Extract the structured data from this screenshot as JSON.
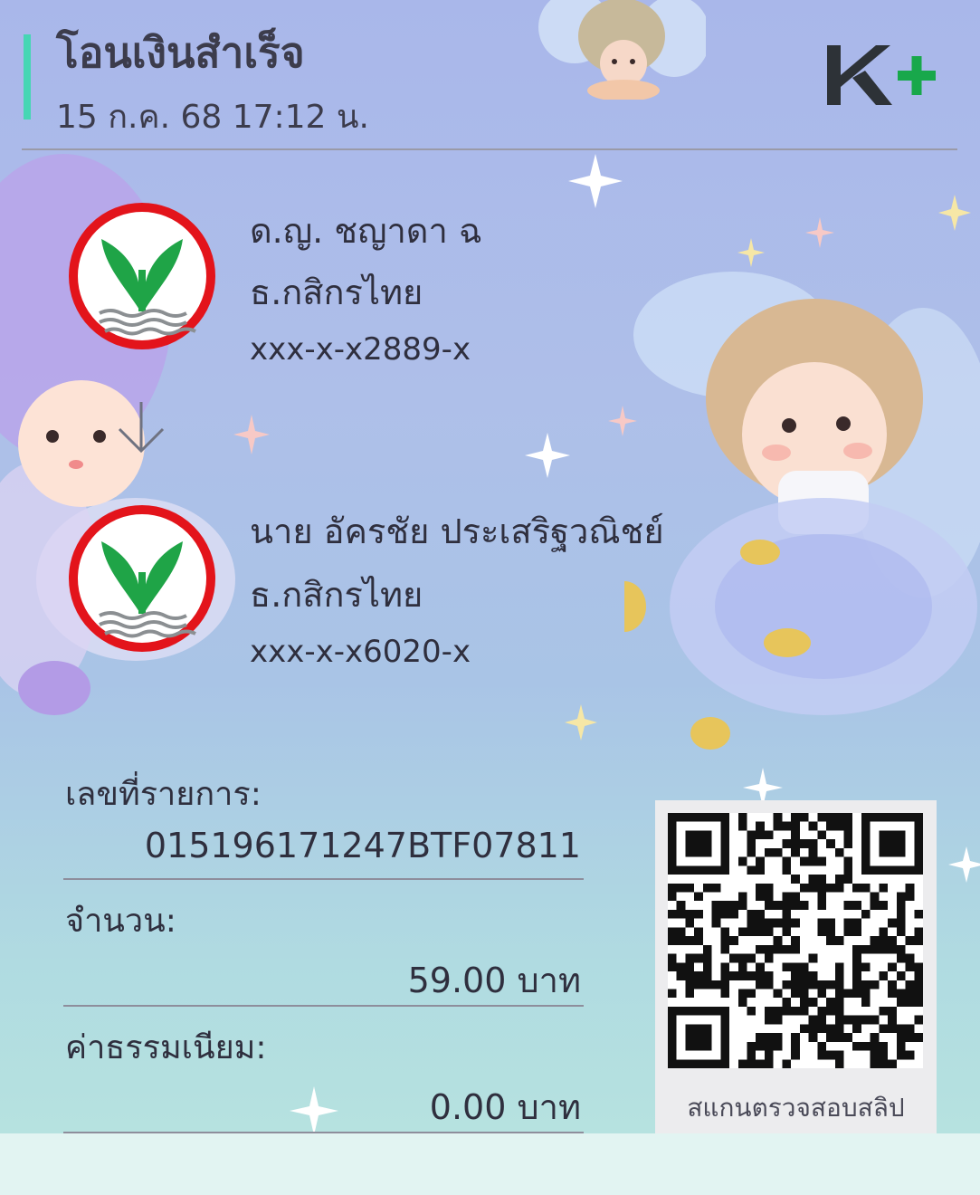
{
  "header": {
    "title": "โอนเงินสำเร็จ",
    "datetime": "15 ก.ค. 68  17:12 น.",
    "brand_logo": "k-plus-logo",
    "accent_color": "#46d6b4",
    "brand_green": "#18a84b"
  },
  "sender": {
    "name": "ด.ญ. ชญาดา ฉ",
    "bank": "ธ.กสิกรไทย",
    "account": "xxx-x-x2889-x",
    "logo": "kasikorn-bank-icon"
  },
  "arrow_icon": "arrow-down-icon",
  "receiver": {
    "name": "นาย อัครชัย ประเสริฐวณิชย์",
    "bank": "ธ.กสิกรไทย",
    "account": "xxx-x-x6020-x",
    "logo": "kasikorn-bank-icon"
  },
  "details": {
    "ref_label": "เลขที่รายการ:",
    "ref_value": "015196171247BTF07811",
    "amount_label": "จำนวน:",
    "amount_value": "59.00 บาท",
    "fee_label": "ค่าธรรมเนียม:",
    "fee_value": "0.00 บาท"
  },
  "qr": {
    "icon": "qr-code-icon",
    "caption": "สแกนตรวจสอบสลิป"
  }
}
